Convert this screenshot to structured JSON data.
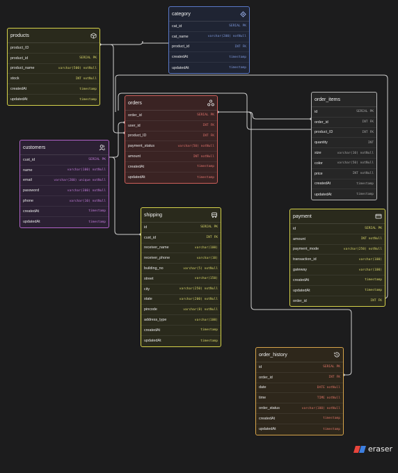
{
  "brand": {
    "name": "eraser",
    "accent_red": "#e8453c",
    "accent_blue": "#3d7fe0"
  },
  "tables": {
    "products": {
      "title": "products",
      "icon": "cube-icon",
      "color": "#d7d44b",
      "rows": [
        [
          "product_ID",
          ""
        ],
        [
          "product_id",
          "SERIAL PK"
        ],
        [
          "product_name",
          "varchar(500) notNull"
        ],
        [
          "stock",
          "INT notNull"
        ],
        [
          "createdAt",
          "timestamp"
        ],
        [
          "updatedAt",
          "timestamp"
        ]
      ]
    },
    "category": {
      "title": "category",
      "icon": "tag-icon",
      "color": "#5a79c8",
      "rows": [
        [
          "cat_id",
          "SERIAL PK"
        ],
        [
          "cat_name",
          "varchar(200) notNull"
        ],
        [
          "product_id",
          "INT FK"
        ],
        [
          "createdAt",
          "timestamp"
        ],
        [
          "updatedAt",
          "timestamp"
        ]
      ]
    },
    "orders": {
      "title": "orders",
      "icon": "network-icon",
      "color": "#d0605b",
      "rows": [
        [
          "order_id",
          "SERIAL PK"
        ],
        [
          "user_id",
          "INT FK"
        ],
        [
          "product_ID",
          "INT FK"
        ],
        [
          "payment_status",
          "varchar(50) notNull"
        ],
        [
          "amount",
          "INT notNull"
        ],
        [
          "createdAt",
          "timestamp"
        ],
        [
          "updatedAt",
          "timestamp"
        ]
      ]
    },
    "order_items": {
      "title": "order_items",
      "icon": "",
      "color": "#b8b8b8",
      "rows": [
        [
          "id",
          "SERIAL PK"
        ],
        [
          "order_id",
          "INT FK"
        ],
        [
          "product_ID",
          "INT FK"
        ],
        [
          "quantity",
          "INT"
        ],
        [
          "size",
          "varchar(10) notNull"
        ],
        [
          "color",
          "varchar(50) notNull"
        ],
        [
          "price",
          "INT notNull"
        ],
        [
          "createdAt",
          "timestamp"
        ],
        [
          "updatedAt",
          "timestamp"
        ]
      ]
    },
    "customers": {
      "title": "customers",
      "icon": "users-icon",
      "color": "#b062c8",
      "rows": [
        [
          "cust_id",
          "SERIAL PK"
        ],
        [
          "name",
          "varchar(100) notNull"
        ],
        [
          "email",
          "varchar(200) unique notNull"
        ],
        [
          "password",
          "varchar(300) notNull"
        ],
        [
          "phone",
          "varchar(10) notNull"
        ],
        [
          "createdAt",
          "timestamp"
        ],
        [
          "updatedAt",
          "timestamp"
        ]
      ]
    },
    "shipping": {
      "title": "shipping",
      "icon": "truck-icon",
      "color": "#d7d44b",
      "rows": [
        [
          "id",
          "SERIAL PK"
        ],
        [
          "cust_id",
          "INT FK"
        ],
        [
          "receiver_name",
          "varchar(100)"
        ],
        [
          "receiver_phone",
          "varchar(10)"
        ],
        [
          "building_no",
          "varchar(5) notNull"
        ],
        [
          "street",
          "varchar(150)"
        ],
        [
          "city",
          "varchar(250) notNull"
        ],
        [
          "state",
          "varchar(200) notNull"
        ],
        [
          "pincode",
          "varchar(8) notNull"
        ],
        [
          "address_type",
          "varchar(100)"
        ],
        [
          "createdAt",
          "timestamp"
        ],
        [
          "updatedAt",
          "timestamp"
        ]
      ]
    },
    "payment": {
      "title": "payment",
      "icon": "card-icon",
      "color": "#d7d44b",
      "rows": [
        [
          "id",
          "SERIAL PK"
        ],
        [
          "amount",
          "INT notNull"
        ],
        [
          "payment_mode",
          "varchar(250) notNull"
        ],
        [
          "transaction_id",
          "varchar(100)"
        ],
        [
          "gateway",
          "varchar(100)"
        ],
        [
          "createdAt",
          "timestamp"
        ],
        [
          "updatedAt",
          "timestamp"
        ],
        [
          "order_id",
          "INT FK"
        ]
      ]
    },
    "order_history": {
      "title": "order_history",
      "icon": "history-icon",
      "color": "#d8a54a",
      "rows": [
        [
          "id",
          "SERIAL PK"
        ],
        [
          "order_id",
          "INT FK"
        ],
        [
          "date",
          "DATE notNull"
        ],
        [
          "time",
          "TIME notNull"
        ],
        [
          "order_status",
          "varchar(100) notNull"
        ],
        [
          "createdAt",
          "timestamp"
        ],
        [
          "updatedAt",
          "timestamp"
        ]
      ]
    }
  }
}
